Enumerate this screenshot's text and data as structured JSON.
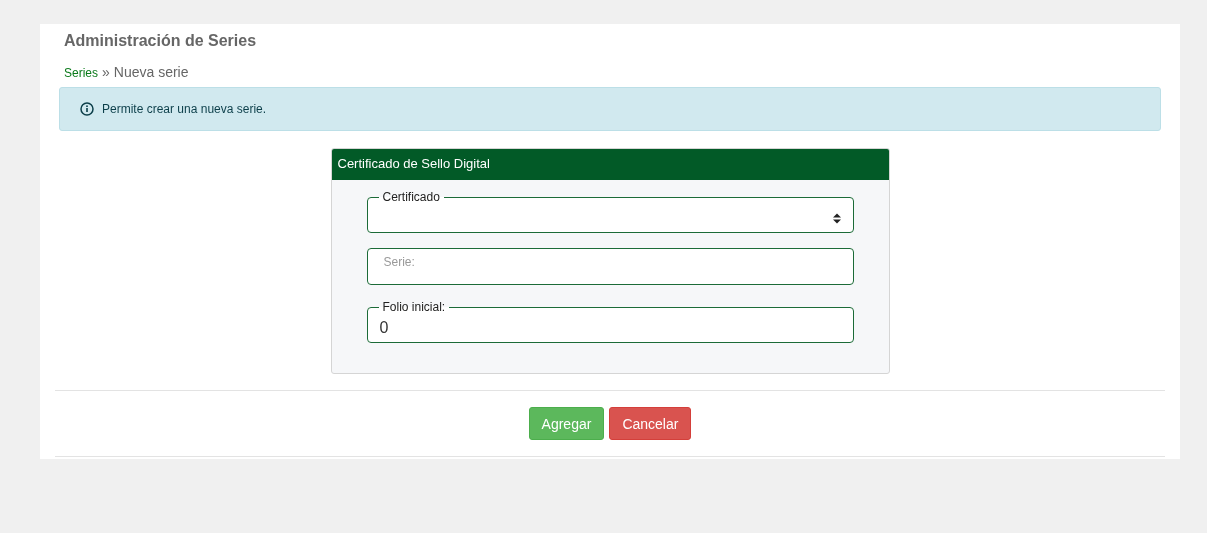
{
  "page": {
    "title": "Administración de Series"
  },
  "breadcrumb": {
    "link": "Series",
    "separator": "»",
    "current": "Nueva serie"
  },
  "alert": {
    "text": "Permite crear una nueva serie."
  },
  "card": {
    "title": "Certificado de Sello Digital",
    "fields": [
      {
        "kind": "select",
        "label": "Certificado"
      },
      {
        "kind": "text",
        "placeholder": "Serie:"
      },
      {
        "kind": "number",
        "label": "Folio inicial:",
        "value": "0"
      }
    ]
  },
  "buttons": [
    {
      "label": "Agregar",
      "kind": "primary"
    },
    {
      "label": "Cancelar",
      "kind": "danger"
    }
  ]
}
